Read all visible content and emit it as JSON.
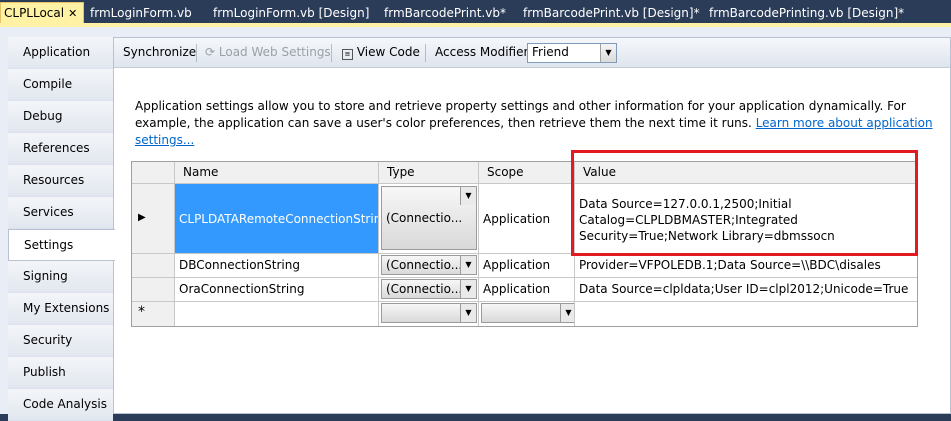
{
  "tabs": [
    {
      "label": "CLPLLocal",
      "active": true
    },
    {
      "label": "frmLoginForm.vb",
      "active": false
    },
    {
      "label": "frmLoginForm.vb [Design]",
      "active": false
    },
    {
      "label": "frmBarcodePrint.vb*",
      "active": false
    },
    {
      "label": "frmBarcodePrint.vb [Design]*",
      "active": false
    },
    {
      "label": "frmBarcodePrinting.vb [Design]*",
      "active": false
    }
  ],
  "nav": [
    {
      "label": "Application"
    },
    {
      "label": "Compile"
    },
    {
      "label": "Debug"
    },
    {
      "label": "References"
    },
    {
      "label": "Resources"
    },
    {
      "label": "Services"
    },
    {
      "label": "Settings",
      "selected": true
    },
    {
      "label": "Signing"
    },
    {
      "label": "My Extensions"
    },
    {
      "label": "Security"
    },
    {
      "label": "Publish"
    },
    {
      "label": "Code Analysis"
    }
  ],
  "toolbar": {
    "synchronize": "Synchronize",
    "load_web_settings": "Load Web Settings",
    "view_code": "View Code",
    "access_modifier_label": "Access Modifier:",
    "access_modifier_value": "Friend"
  },
  "description": {
    "text": "Application settings allow you to store and retrieve property settings and other information for your application dynamically. For example, the application can save a user's color preferences, then retrieve them the next time it runs.",
    "link": "Learn more about application settings..."
  },
  "grid": {
    "headers": {
      "name": "Name",
      "type": "Type",
      "scope": "Scope",
      "value": "Value"
    },
    "rows": [
      {
        "name": "CLPLDATARemoteConnectionString",
        "type": "(Connectio...",
        "scope": "Application",
        "value": "Data Source=127.0.0.1,2500;Initial Catalog=CLPLDBMASTER;Integrated Security=True;Network Library=dbmssocn"
      },
      {
        "name": "DBConnectionString",
        "type": "(Connectio...",
        "scope": "Application",
        "value": "Provider=VFPOLEDB.1;Data Source=\\\\BDC\\disales"
      },
      {
        "name": "OraConnectionString",
        "type": "(Connectio...",
        "scope": "Application",
        "value": "Data Source=clpldata;User ID=clpl2012;Unicode=True"
      }
    ],
    "new_row_marker": "*"
  },
  "colors": {
    "tab_bg": "#2b3c59",
    "active_tab": "#fff2a4",
    "selection": "#3399ff",
    "highlight_box": "#e21b23",
    "link": "#0066cc"
  }
}
